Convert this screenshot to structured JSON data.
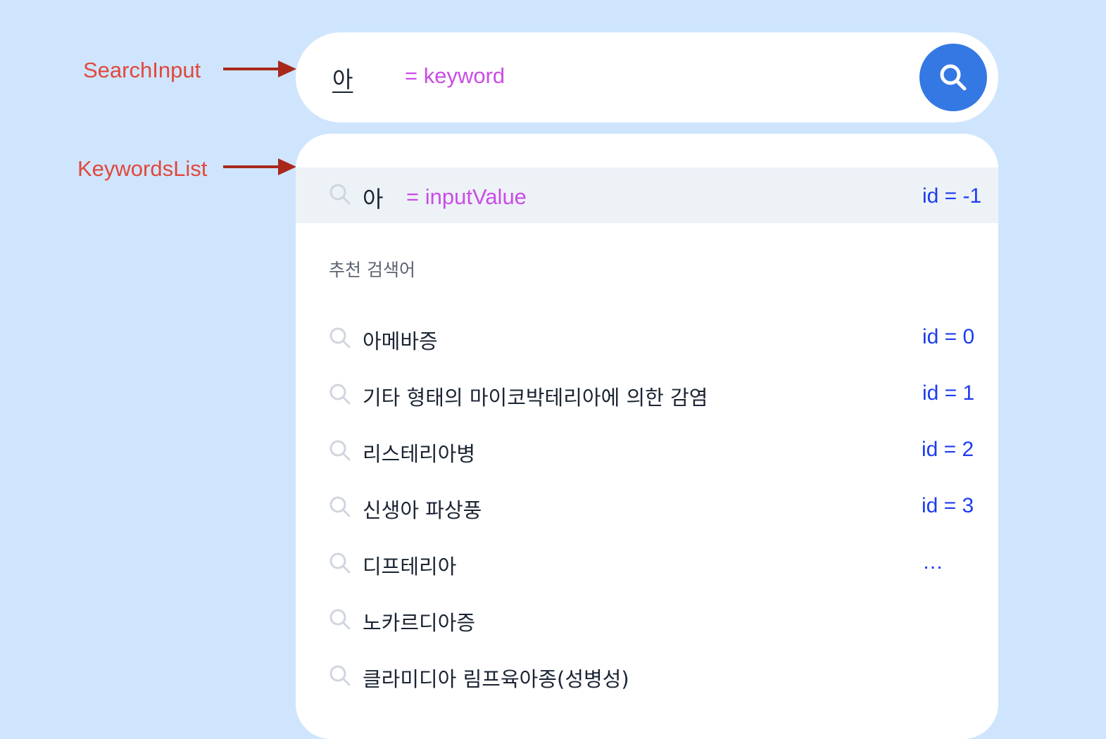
{
  "annotations": {
    "search_input": "SearchInput",
    "keywords_list": "KeywordsList"
  },
  "search": {
    "value": "아",
    "note": "= keyword"
  },
  "current": {
    "value": "아",
    "note": "= inputValue",
    "id_label": "id = -1"
  },
  "section_title": "추천 검색어",
  "keywords": [
    {
      "text": "아메바증",
      "id_label": "id = 0"
    },
    {
      "text": "기타 형태의 마이코박테리아에 의한 감염",
      "id_label": "id = 1"
    },
    {
      "text": "리스테리아병",
      "id_label": "id = 2"
    },
    {
      "text": "신생아 파상풍",
      "id_label": "id = 3"
    },
    {
      "text": "디프테리아",
      "id_label": "…"
    },
    {
      "text": "노카르디아증",
      "id_label": ""
    },
    {
      "text": "클라미디아 림프육아종(성병성)",
      "id_label": ""
    }
  ],
  "colors": {
    "background": "#cfe5fd",
    "accent": "#3478e3",
    "annotation": "#e0483d",
    "note": "#c94de6",
    "id_label": "#1d3cf0"
  },
  "icons": {
    "search_button": "search-icon",
    "row": "search-icon",
    "arrow": "arrow-right-icon"
  }
}
